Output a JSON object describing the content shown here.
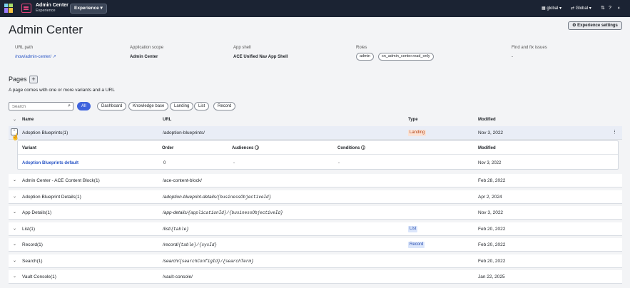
{
  "topbar": {
    "app_title": "Admin Center",
    "app_subtitle": "Experience",
    "experience_menu": "Experience",
    "scope_menu": "global",
    "language_menu": "Global"
  },
  "page_title": "Admin Center",
  "experience_settings": "Experience settings",
  "meta": {
    "url_path_label": "URL path",
    "url_path_value": "/now/admin-center/",
    "app_scope_label": "Application scope",
    "app_scope_value": "Admin Center",
    "app_shell_label": "App shell",
    "app_shell_value": "ACE Unified Nav App Shell",
    "roles_label": "Roles",
    "roles": [
      "admin",
      "sn_admin_center.read_only"
    ],
    "issues_label": "Find and fix issues",
    "issues_value": "-"
  },
  "pages": {
    "heading": "Pages",
    "add_label": "+",
    "description": "A page comes with one or more variants and a URL",
    "search_placeholder": "Search",
    "filters": [
      "All",
      "Dashboard",
      "Knowledge base",
      "Landing",
      "List",
      "Record"
    ],
    "active_filter": "All",
    "columns": {
      "name": "Name",
      "url": "URL",
      "type": "Type",
      "modified": "Modified"
    },
    "rows": [
      {
        "name": "Adoption Blueprints(1)",
        "url": "/adoption-blueprints/",
        "url_params": "",
        "type": "Landing",
        "modified": "Nov 3, 2022"
      },
      {
        "name": "Admin Center - ACE Content Block(1)",
        "url": "/ace-content-block/",
        "url_params": "",
        "type": "",
        "modified": "Feb 28, 2022"
      },
      {
        "name": "Adoption Blueprint Details(1)",
        "url": "/adoption-blueprint-details/",
        "url_params": "{businessObjectiveId}",
        "type": "",
        "modified": "Apr 2, 2024"
      },
      {
        "name": "App Details(1)",
        "url": "/app-details/",
        "url_params": "{applicationId}/{businessObjectiveId}",
        "type": "",
        "modified": "Nov 3, 2022"
      },
      {
        "name": "List(1)",
        "url": "/list/",
        "url_params": "{table}",
        "type": "List",
        "modified": "Feb 20, 2022"
      },
      {
        "name": "Record(1)",
        "url": "/record/",
        "url_params": "{table}/{sysId}",
        "type": "Record",
        "modified": "Feb 20, 2022"
      },
      {
        "name": "Search(1)",
        "url": "/search/",
        "url_params": "{searchConfigId}/{searchTerm}",
        "type": "",
        "modified": "Feb 20, 2022"
      },
      {
        "name": "Vault Console(1)",
        "url": "/vault-console/",
        "url_params": "",
        "type": "",
        "modified": "Jan 22, 2025"
      }
    ],
    "variants": {
      "columns": {
        "variant": "Variant",
        "order": "Order",
        "audiences": "Audiences",
        "conditions": "Conditions",
        "modified": "Modified"
      },
      "rows": [
        {
          "variant": "Adoption Blueprints default",
          "order": "0",
          "audiences": "-",
          "conditions": "-",
          "modified": "Nov 3, 2022"
        }
      ]
    }
  }
}
